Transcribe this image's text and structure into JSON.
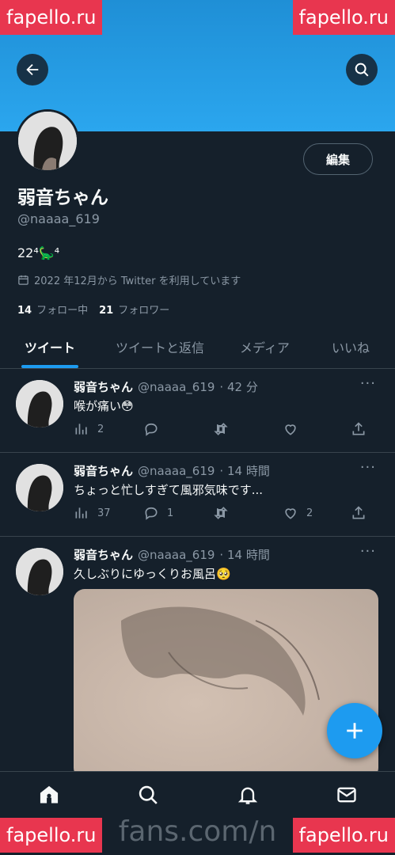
{
  "watermark": {
    "text": "fapello.ru"
  },
  "bottom_url": "fans.com/n",
  "profile": {
    "display_name": "弱音ちゃん",
    "handle": "@naaaa_619",
    "bio": "22⁴🦕⁴",
    "joined": "2022 年12月から Twitter を利用しています",
    "following_count": "14",
    "following_label": "フォロー中",
    "followers_count": "21",
    "followers_label": "フォロワー",
    "edit_label": "編集"
  },
  "tabs": [
    {
      "label": "ツイート",
      "active": true
    },
    {
      "label": "ツイートと返信",
      "active": false
    },
    {
      "label": "メディア",
      "active": false
    },
    {
      "label": "いいね",
      "active": false
    }
  ],
  "tweets": [
    {
      "name": "弱音ちゃん",
      "handle": "@naaaa_619",
      "time": "· 42 分",
      "text": "喉が痛い😳",
      "views": "2",
      "replies": "",
      "retweets": "",
      "likes": ""
    },
    {
      "name": "弱音ちゃん",
      "handle": "@naaaa_619",
      "time": "· 14 時間",
      "text": "ちょっと忙しすぎて風邪気味です...",
      "views": "37",
      "replies": "1",
      "retweets": "",
      "likes": "2"
    },
    {
      "name": "弱音ちゃん",
      "handle": "@naaaa_619",
      "time": "· 14 時間",
      "text": "久しぶりにゆっくりお風呂🥺",
      "views": "",
      "replies": "",
      "retweets": "",
      "likes": ""
    }
  ],
  "icons": {
    "back": "arrow-left-icon",
    "search": "search-icon",
    "calendar": "calendar-icon",
    "more": "more-icon",
    "views": "bar-chart-icon",
    "reply": "reply-icon",
    "retweet": "retweet-icon",
    "like": "heart-icon",
    "share": "share-icon",
    "compose": "plus-icon",
    "home": "home-icon",
    "explore": "search-icon",
    "notifications": "bell-icon",
    "messages": "mail-icon"
  },
  "colors": {
    "accent": "#1d9bf0",
    "background": "#15202b",
    "muted": "#8b98a5",
    "watermark": "#e8364f"
  }
}
